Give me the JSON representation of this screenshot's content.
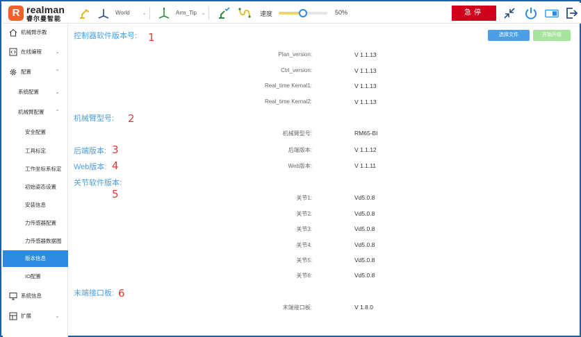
{
  "logo": {
    "mark": "R",
    "brand": "realman",
    "sub": "睿尔曼智能"
  },
  "toolbar": {
    "frame_select": "World",
    "tool_select": "Arm_Tip",
    "speed_label": "速度",
    "speed_value": "50%",
    "speed_fraction": 0.5,
    "estop_label": "急停"
  },
  "sidebar": {
    "items": [
      {
        "label": "机械臂示教"
      },
      {
        "label": "在线编程"
      },
      {
        "label": "配置"
      },
      {
        "label": "系统配置"
      },
      {
        "label": "机械臂配置"
      },
      {
        "label": "安全配置"
      },
      {
        "label": "工具标定"
      },
      {
        "label": "工作坐标系标定"
      },
      {
        "label": "初始姿态设置"
      },
      {
        "label": "安装信息"
      },
      {
        "label": "力传感器配置"
      },
      {
        "label": "力传感器数据图"
      },
      {
        "label": "版本信息"
      },
      {
        "label": "IO配置"
      },
      {
        "label": "系统信息"
      },
      {
        "label": "扩展"
      }
    ]
  },
  "main": {
    "buttons": {
      "select_file": "选择文件",
      "start_upgrade": "开始升级"
    },
    "sections": [
      {
        "title": "控制器软件版本号:",
        "annot": "1"
      },
      {
        "title": "机械臂型号:",
        "annot": "2"
      },
      {
        "title": "后端版本:",
        "annot": "3"
      },
      {
        "title": "Web版本:",
        "annot": "4"
      },
      {
        "title": "关节软件版本:",
        "annot": "5"
      },
      {
        "title": "末端接口板:",
        "annot": "6"
      }
    ],
    "controller": [
      {
        "label": "Plan_version:",
        "value": "V 1.1.13"
      },
      {
        "label": "Ctrl_version:",
        "value": "V 1.1.13"
      },
      {
        "label": "Real_time Kernal1:",
        "value": "V 1.1.13"
      },
      {
        "label": "Real_time Kernal2:",
        "value": "V 1.1.13"
      }
    ],
    "arm_model": {
      "label": "机械臂型号:",
      "value": "RM65-BI"
    },
    "backend": {
      "label": "后端版本:",
      "value": "V 1.1.12"
    },
    "web": {
      "label": "Web版本:",
      "value": "V 1.1.11"
    },
    "joints": [
      {
        "label": "关节1:",
        "value": "Vd5.0.8"
      },
      {
        "label": "关节2:",
        "value": "Vd5.0.8"
      },
      {
        "label": "关节3:",
        "value": "Vd5.0.8"
      },
      {
        "label": "关节4:",
        "value": "Vd5.0.8"
      },
      {
        "label": "关节5:",
        "value": "Vd5.0.8"
      },
      {
        "label": "关节6:",
        "value": "Vd5.0.8"
      }
    ],
    "end_board": {
      "label": "末端接口板:",
      "value": "V 1.8.0"
    }
  },
  "colors": {
    "accent": "#2d8ae3",
    "section": "#4a9fe8",
    "annot": "#e03a2f",
    "estop": "#d0021b",
    "upgrade_disabled": "#a9e3a0"
  }
}
